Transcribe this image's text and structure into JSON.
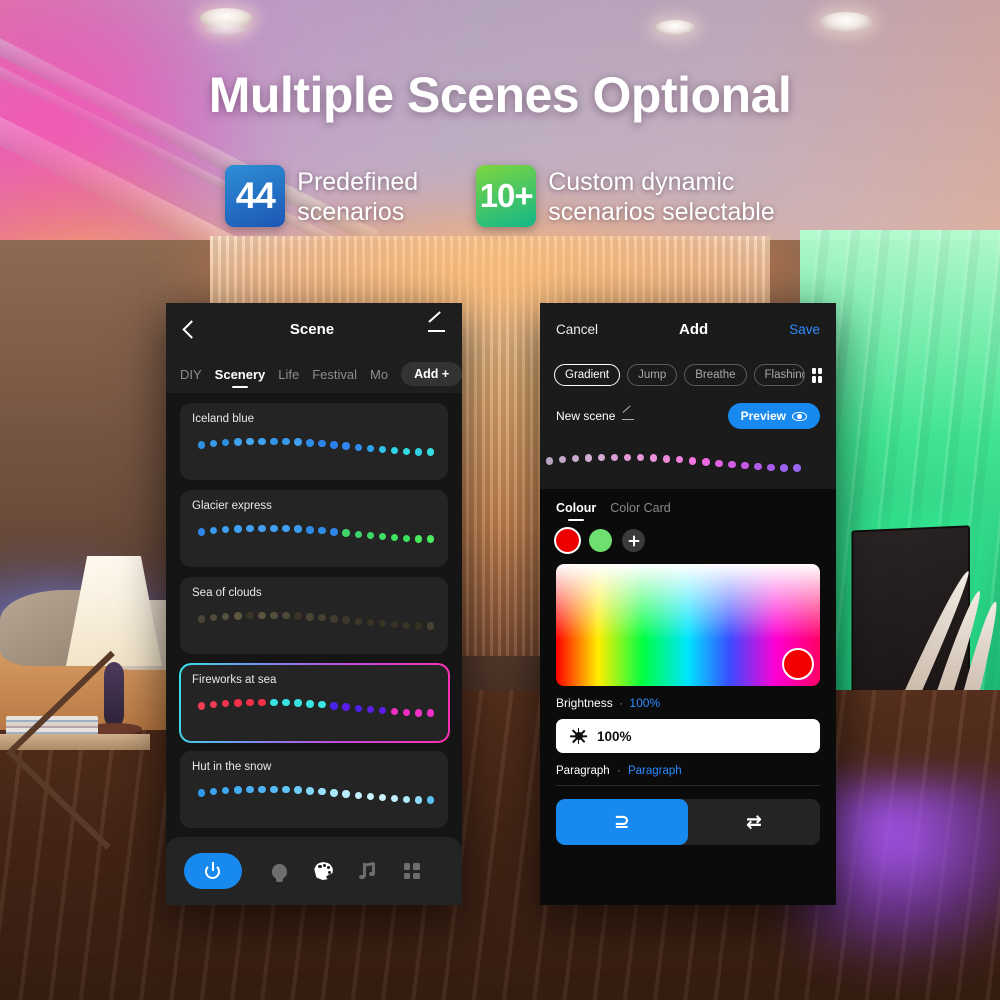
{
  "hero": {
    "headline": "Multiple Scenes Optional",
    "badges": [
      {
        "count": "44",
        "line1": "Predefined",
        "line2": "scenarios",
        "color": "#1b56b5"
      },
      {
        "count": "10+",
        "line1": "Custom dynamic",
        "line2": "scenarios selectable",
        "color": "#13b789"
      }
    ]
  },
  "left_phone": {
    "header": {
      "back_icon": "chevron-left-icon",
      "title": "Scene",
      "edit_icon": "pencil-icon"
    },
    "tabs": [
      {
        "label": "DIY",
        "active": false
      },
      {
        "label": "Scenery",
        "active": true
      },
      {
        "label": "Life",
        "active": false
      },
      {
        "label": "Festival",
        "active": false
      },
      {
        "label": "Mo",
        "active": false
      }
    ],
    "add_button": "Add +",
    "scenes": [
      {
        "name": "Iceland blue",
        "selected": false,
        "colors": [
          "#2f8fe0",
          "#3a9ae8",
          "#2f8fe0",
          "#3fa0ec",
          "#46a6ef",
          "#3fa0ec",
          "#3694e6",
          "#3a9ae8",
          "#3f9fec",
          "#2f8ce6",
          "#2f86e8",
          "#2a7fea",
          "#2f86ef",
          "#2f8ef0",
          "#2fa4ee",
          "#2fc3ea",
          "#2fd4e6",
          "#34dbe2",
          "#2fd0e4",
          "#35dde0"
        ]
      },
      {
        "name": "Glacier express",
        "selected": false,
        "colors": [
          "#2f86e8",
          "#3a9aee",
          "#3f9ff0",
          "#3f9ff0",
          "#3f9ff0",
          "#469fef",
          "#3f9ff0",
          "#3f9ff0",
          "#3b9bee",
          "#2f8ce6",
          "#2f8ce6",
          "#2f86e8",
          "#3fd46a",
          "#3fd46a",
          "#3ed866",
          "#3ede62",
          "#3fe25f",
          "#3ae35c",
          "#46e85c",
          "#4aea5e"
        ]
      },
      {
        "name": "Sea of clouds",
        "selected": false,
        "colors": [
          "#4a4438",
          "#504a3c",
          "#565040",
          "#5c5642",
          "",
          "#5a5440",
          "#544e3c",
          "#4e4838",
          "",
          "#4a4434",
          "#464032",
          "#423c30",
          "#3e382c",
          "#3c3628",
          "",
          "#3a3426",
          "#383224",
          "",
          "#363022",
          "#484232"
        ]
      },
      {
        "name": "Fireworks at sea",
        "selected": true,
        "colors": [
          "#ef3d55",
          "#f03a55",
          "#f23450",
          "#f2304c",
          "#f2304c",
          "#f23048",
          "#38e0e0",
          "#38e0e0",
          "#38e0e0",
          "#3ae4e4",
          "#3ae4e4",
          "#4a22e8",
          "#5a1ee8",
          "#4a22e8",
          "#5a1ee8",
          "#5a1ee8",
          "#ee30c0",
          "#ee2cc4",
          "#ef32c8",
          "#f030cc"
        ]
      },
      {
        "name": "Hut in the snow",
        "selected": false,
        "colors": [
          "#2f9ae8",
          "#3aa4ee",
          "#3fa8f0",
          "#44acf2",
          "#49b0f4",
          "#4cb4f6",
          "#56bcf8",
          "#60c4f8",
          "#6cccf8",
          "#82d6f8",
          "#96e0fa",
          "#a8e8fa",
          "#b8eefb",
          "#c2f1fc",
          "#c8f3fc",
          "#cdf5fd",
          "#c2f1fc",
          "#aeeafa",
          "#8fdcf8",
          "#5ac0f4"
        ]
      }
    ],
    "bottom_bar": {
      "power": "power-icon",
      "icons": [
        "bulb-icon",
        "palette-icon",
        "music-note-icon",
        "grid-icon"
      ]
    }
  },
  "right_phone": {
    "header": {
      "cancel": "Cancel",
      "title": "Add",
      "save": "Save"
    },
    "modes": [
      {
        "label": "Gradient",
        "active": true
      },
      {
        "label": "Jump",
        "active": false
      },
      {
        "label": "Breathe",
        "active": false
      },
      {
        "label": "Flashing",
        "active": false
      }
    ],
    "mode_grid_icon": "grid-icon",
    "scene_row": {
      "name": "New scene",
      "edit_icon": "pencil-icon",
      "preview": "Preview",
      "preview_icon": "eye-icon"
    },
    "preview_colors": [
      "#b8a6c0",
      "#c2aac6",
      "#c8accb",
      "#cfaed0",
      "#d5add4",
      "#dc9ed2",
      "#e39ad4",
      "#e896d6",
      "#ec90d8",
      "#ee8ada",
      "#f080dd",
      "#f274e0",
      "#ec6ae0",
      "#e062e2",
      "#d25ce4",
      "#c45ae6",
      "#b05ae8",
      "#a85ceb",
      "#9a60ee",
      "#9a66f0"
    ],
    "color_tabs": [
      {
        "label": "Colour",
        "active": true
      },
      {
        "label": "Color Card",
        "active": false
      }
    ],
    "swatches": [
      {
        "hex": "#ef0000",
        "selected": true
      },
      {
        "hex": "#6fe06f",
        "selected": false
      }
    ],
    "swatch_add_icon": "plus-icon",
    "picker_knob_hex": "#f40000",
    "brightness": {
      "label": "Brightness",
      "separator": "·",
      "value": "100%"
    },
    "slider": {
      "icon": "sun-icon",
      "value": "100%"
    },
    "paragraph_row": {
      "label": "Paragraph",
      "separator": "·",
      "link": "Paragraph"
    },
    "segments": [
      {
        "glyph": "⊇",
        "active": true
      },
      {
        "glyph": "⇄",
        "active": false
      }
    ]
  }
}
